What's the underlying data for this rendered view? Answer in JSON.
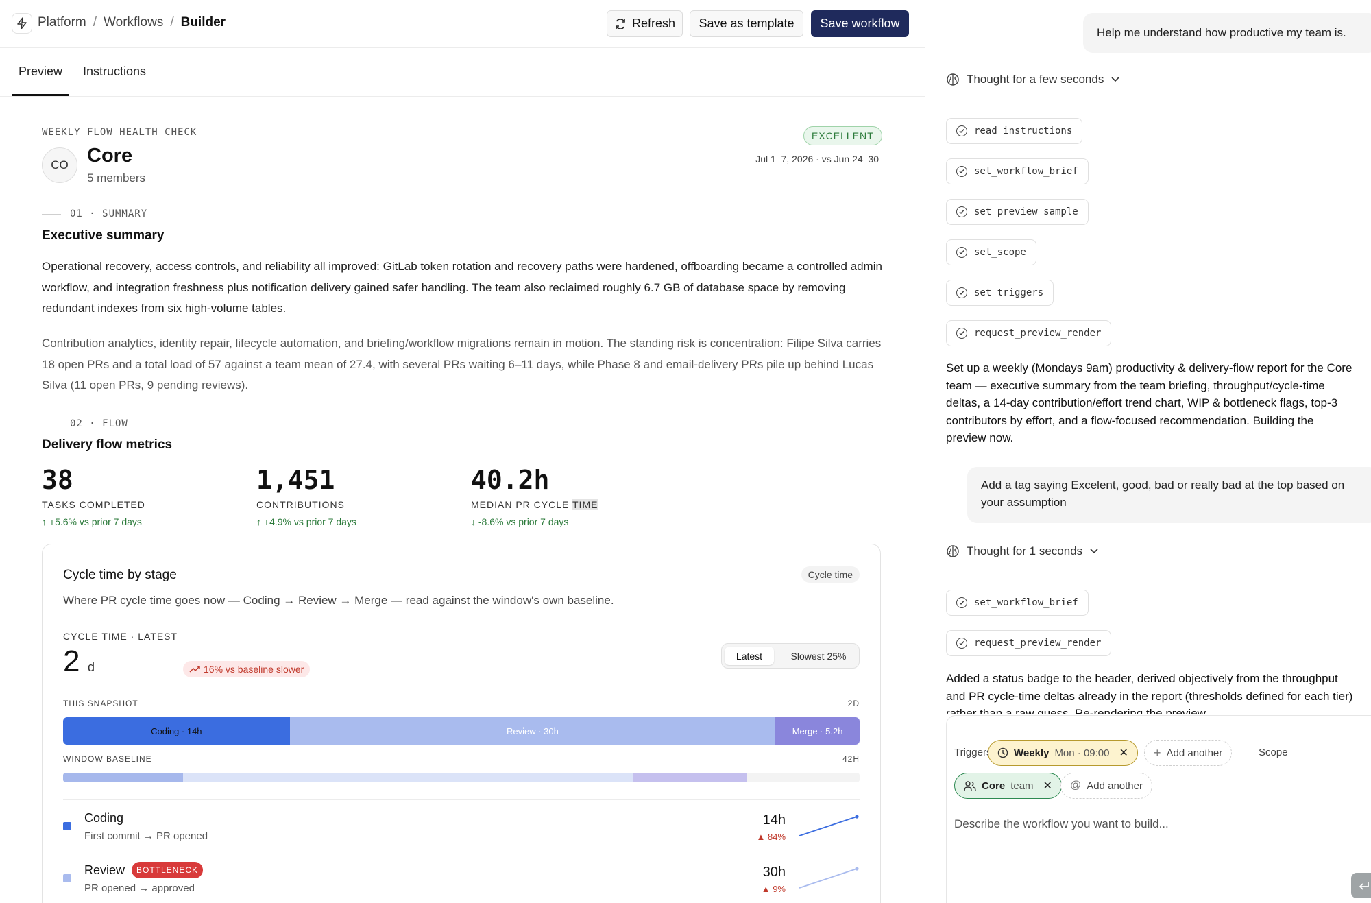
{
  "topbar": {
    "breadcrumbs": [
      "Platform",
      "Workflows",
      "Builder"
    ],
    "refresh_label": "Refresh",
    "save_template_label": "Save as template",
    "save_workflow_label": "Save workflow"
  },
  "tabs": [
    {
      "label": "Preview",
      "active": true
    },
    {
      "label": "Instructions",
      "active": false
    }
  ],
  "report": {
    "label": "WEEKLY FLOW HEALTH CHECK",
    "avatar": "CO",
    "team_name": "Core",
    "members": "5 members",
    "status_badge": "EXCELLENT",
    "date_range": "Jul 1–7, 2026 · vs Jun 24–30"
  },
  "summary": {
    "section_label": "01 · SUMMARY",
    "heading": "Executive summary",
    "paragraphs": [
      "Operational recovery, access controls, and reliability all improved: GitLab token rotation and recovery paths were hardened, offboarding became a controlled admin workflow, and integration freshness plus notification delivery gained safer handling. The team also reclaimed roughly 6.7 GB of database space by removing redundant indexes from six high-volume tables.",
      "Contribution analytics, identity repair, lifecycle automation, and briefing/workflow migrations remain in motion. The standing risk is concentration: Filipe Silva carries 18 open PRs and a total load of 57 against a team mean of 27.4, with several PRs waiting 6–11 days, while Phase 8 and email-delivery PRs pile up behind Lucas Silva (11 open PRs, 9 pending reviews)."
    ]
  },
  "flow": {
    "section_label": "02 · FLOW",
    "heading": "Delivery flow metrics",
    "metrics": [
      {
        "value": "38",
        "label": "TASKS COMPLETED",
        "delta": "↑ +5.6% vs prior 7 days"
      },
      {
        "value": "1,451",
        "label": "CONTRIBUTIONS",
        "delta": "↑ +4.9% vs prior 7 days"
      },
      {
        "value": "40.2h",
        "label_a": "MEDIAN PR CYCLE ",
        "label_b": "TIME",
        "delta": "↓ -8.6% vs prior 7 days"
      }
    ]
  },
  "cycle_card": {
    "title": "Cycle time by stage",
    "chip": "Cycle time",
    "subtitle": "Where PR cycle time goes now — Coding → Review → Merge — read against the window's own baseline.",
    "ct_label": "CYCLE TIME · LATEST",
    "ct_value": "2",
    "ct_unit": "d",
    "ct_badge": "16% vs baseline slower",
    "toggle": {
      "latest": "Latest",
      "slowest": "Slowest 25%"
    },
    "snapshot_label": "THIS SNAPSHOT",
    "snapshot_max": "2D",
    "baseline_label": "WINDOW BASELINE",
    "baseline_max": "42H",
    "snapshot_segments": [
      {
        "label": "Coding · 14h",
        "hours": 14,
        "color": "#3b6de0",
        "text_color": "#111111"
      },
      {
        "label": "Review · 30h",
        "hours": 30,
        "color": "#a9bbee",
        "text_color": "#ffffff"
      },
      {
        "label": "Merge · 5.2h",
        "hours": 5.2,
        "color": "#8a86dc",
        "text_color": "#ffffff"
      }
    ],
    "baseline_segments": [
      {
        "fraction": 0.151,
        "color": "#a6b8ec"
      },
      {
        "fraction": 0.564,
        "color": "#dbe3f8"
      },
      {
        "fraction": 0.144,
        "color": "#c5c0ee"
      }
    ],
    "stages": [
      {
        "name": "Coding",
        "description": "First commit → PR opened",
        "hours": "14h",
        "change": "▲ 84%",
        "color": "#3b6de0",
        "trend": [
          0,
          1
        ]
      },
      {
        "name": "Review",
        "tag": "BOTTLENECK",
        "description": "PR opened → approved",
        "hours": "30h",
        "change": "▲ 9%",
        "color": "#a9bbee",
        "trend": [
          0,
          1
        ]
      }
    ]
  },
  "chat": {
    "msg1": "Help me understand how productive my team is.",
    "thought1": "Thought for a few seconds",
    "tools1": [
      "read_instructions",
      "set_workflow_brief",
      "set_preview_sample",
      "set_scope",
      "set_triggers",
      "request_preview_render"
    ],
    "reply1": "Set up a weekly (Mondays 9am) productivity & delivery-flow report for the Core team — executive summary from the team briefing, throughput/cycle-time deltas, a 14-day contribution/effort trend chart, WIP & bottleneck flags, top-3 contributors by effort, and a flow-focused recommendation. Building the preview now.",
    "msg2": "Add a tag saying Excelent, good, bad or really bad at the top based on your assumption",
    "thought2": "Thought for 1 seconds",
    "tools2": [
      "set_workflow_brief",
      "request_preview_render"
    ],
    "reply2": "Added a status badge to the header, derived objectively from the throughput and PR cycle-time deltas already in the report (thresholds defined for each tier) rather than a raw guess. Re-rendering the preview"
  },
  "composer": {
    "triggers_label": "Triggers",
    "trigger_name": "Weekly",
    "trigger_detail": "Mon · 09:00",
    "add_trigger": "Add another",
    "scope_label": "Scope",
    "scope_name": "Core",
    "scope_detail": "team",
    "add_scope": "Add another",
    "placeholder": "Describe the workflow you want to build..."
  }
}
